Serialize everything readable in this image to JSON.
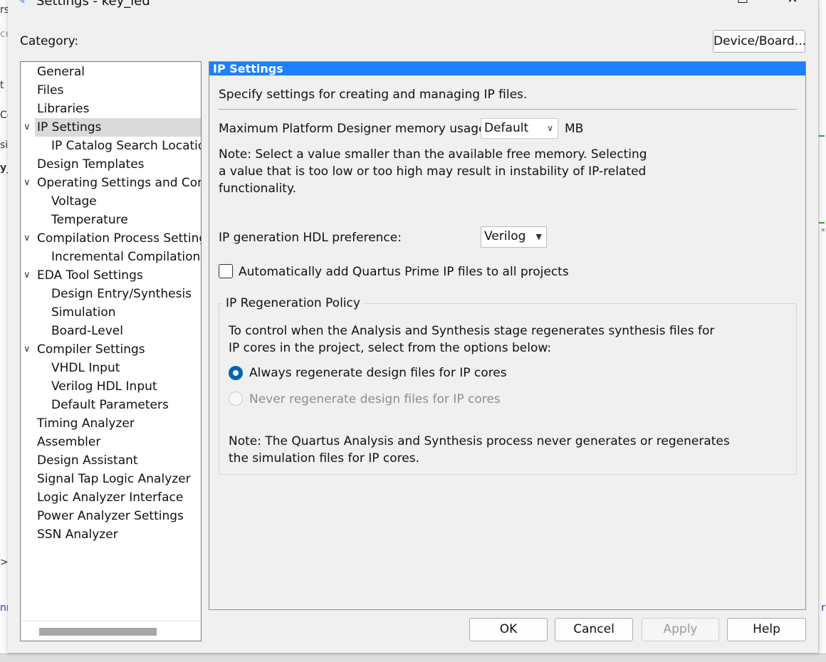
{
  "window": {
    "title": "Settings - key_led",
    "controls": {
      "minimize": "—",
      "maximize": "☐",
      "close": "✕"
    }
  },
  "background_fragments": {
    "left": [
      "rs",
      "ce",
      "t",
      "Co",
      "sic",
      "y_",
      ">",
      "nn"
    ],
    "right": [
      "*",
      "r"
    ]
  },
  "category_label": "Category:",
  "device_board_button": "Device/Board...",
  "tree": {
    "items": [
      {
        "label": "General",
        "level": 0,
        "expander": ""
      },
      {
        "label": "Files",
        "level": 0,
        "expander": ""
      },
      {
        "label": "Libraries",
        "level": 0,
        "expander": ""
      },
      {
        "label": "IP Settings",
        "level": 0,
        "expander": "∨",
        "selected": true
      },
      {
        "label": "IP Catalog Search Locations",
        "level": 1,
        "expander": ""
      },
      {
        "label": "Design Templates",
        "level": 0,
        "expander": ""
      },
      {
        "label": "Operating Settings and Conditions",
        "level": 0,
        "expander": "∨"
      },
      {
        "label": "Voltage",
        "level": 1,
        "expander": ""
      },
      {
        "label": "Temperature",
        "level": 1,
        "expander": ""
      },
      {
        "label": "Compilation Process Settings",
        "level": 0,
        "expander": "∨"
      },
      {
        "label": "Incremental Compilation",
        "level": 1,
        "expander": ""
      },
      {
        "label": "EDA Tool Settings",
        "level": 0,
        "expander": "∨"
      },
      {
        "label": "Design Entry/Synthesis",
        "level": 1,
        "expander": ""
      },
      {
        "label": "Simulation",
        "level": 1,
        "expander": ""
      },
      {
        "label": "Board-Level",
        "level": 1,
        "expander": ""
      },
      {
        "label": "Compiler Settings",
        "level": 0,
        "expander": "∨"
      },
      {
        "label": "VHDL Input",
        "level": 1,
        "expander": ""
      },
      {
        "label": "Verilog HDL Input",
        "level": 1,
        "expander": ""
      },
      {
        "label": "Default Parameters",
        "level": 1,
        "expander": ""
      },
      {
        "label": "Timing Analyzer",
        "level": 0,
        "expander": ""
      },
      {
        "label": "Assembler",
        "level": 0,
        "expander": ""
      },
      {
        "label": "Design Assistant",
        "level": 0,
        "expander": ""
      },
      {
        "label": "Signal Tap Logic Analyzer",
        "level": 0,
        "expander": ""
      },
      {
        "label": "Logic Analyzer Interface",
        "level": 0,
        "expander": ""
      },
      {
        "label": "Power Analyzer Settings",
        "level": 0,
        "expander": ""
      },
      {
        "label": "SSN Analyzer",
        "level": 0,
        "expander": ""
      }
    ]
  },
  "panel": {
    "header": "IP Settings",
    "intro": "Specify settings for creating and managing IP files.",
    "memory_label": "Maximum Platform Designer memory usage:",
    "memory_value": "Default",
    "memory_unit": "MB",
    "note_lines": [
      "Note: Select a value smaller than the available free memory. Selecting",
      "a value that is too low or too high may result in instability of IP-related",
      "functionality."
    ],
    "hdl_label": "IP generation HDL preference:",
    "hdl_value": "Verilog",
    "auto_add_label": "Automatically add Quartus Prime IP files to all projects",
    "auto_add_checked": false,
    "regen": {
      "title": "IP Regeneration Policy",
      "desc_lines": [
        "To control when the Analysis and Synthesis stage regenerates synthesis files for",
        "IP cores in the project, select from the options below:"
      ],
      "option_always": "Always regenerate design files for IP cores",
      "option_never": "Never regenerate design files for IP cores",
      "selected": "always",
      "note_lines": [
        "Note: The Quartus Analysis and Synthesis process never generates or regenerates",
        "the simulation files for IP cores."
      ]
    }
  },
  "buttons": {
    "ok": "OK",
    "cancel": "Cancel",
    "apply": "Apply",
    "help": "Help"
  },
  "colors": {
    "header_blue": "#1e7fff",
    "radio_blue": "#0063b1",
    "selection_gray": "#dadada"
  }
}
